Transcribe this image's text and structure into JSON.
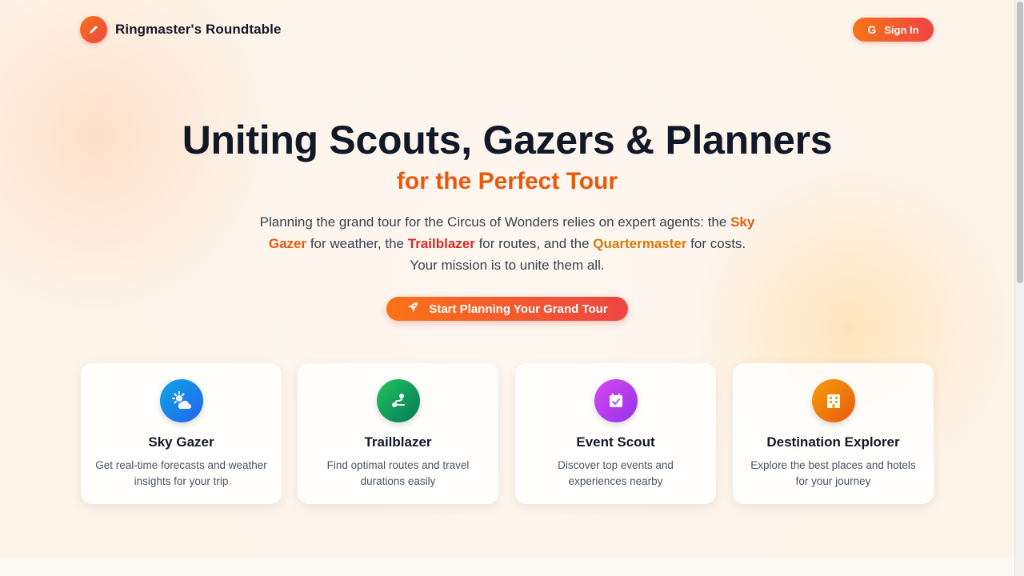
{
  "header": {
    "brand": "Ringmaster's Roundtable",
    "signin_label": "Sign In",
    "signin_icon_glyph": "G"
  },
  "hero": {
    "title": "Uniting Scouts, Gazers & Planners",
    "subtitle": "for the Perfect Tour",
    "desc_part1": "Planning the grand tour for the Circus of Wonders relies on expert agents: the ",
    "desc_sky": "Sky Gazer",
    "desc_part2": " for weather, the ",
    "desc_trail": "Trailblazer",
    "desc_part3": " for routes, and the ",
    "desc_quarter": "Quartermaster",
    "desc_part4": " for costs. Your mission is to unite them all.",
    "cta_label": "Start Planning Your Grand Tour"
  },
  "cards": [
    {
      "title": "Sky Gazer",
      "desc": "Get real-time forecasts and weather insights for your trip",
      "icon": "weather-icon"
    },
    {
      "title": "Trailblazer",
      "desc": "Find optimal routes and travel durations easily",
      "icon": "route-icon"
    },
    {
      "title": "Event Scout",
      "desc": "Discover top events and experiences nearby",
      "icon": "calendar-icon"
    },
    {
      "title": "Destination Explorer",
      "desc": "Explore the best places and hotels for your journey",
      "icon": "hotel-icon"
    }
  ],
  "colors": {
    "accent_orange": "#f97316",
    "accent_red": "#ef4444",
    "text_dark": "#111827"
  }
}
